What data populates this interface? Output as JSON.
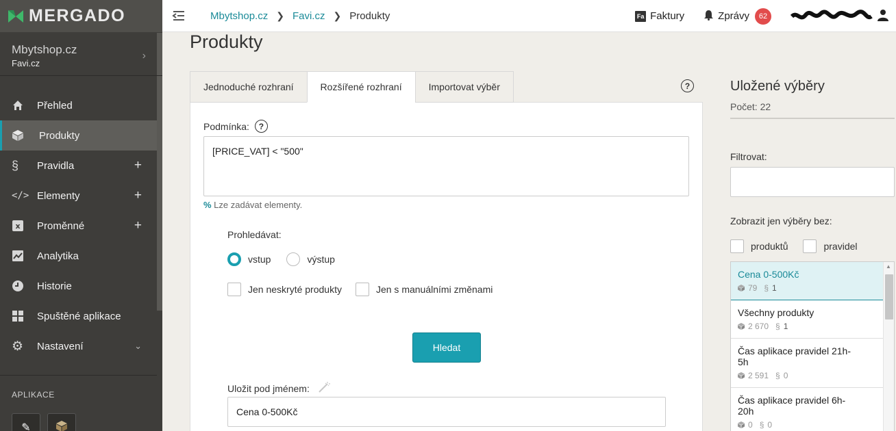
{
  "logo": {
    "text": "MERGADO"
  },
  "shop": {
    "name": "Mbytshop.cz",
    "sub": "Favi.cz"
  },
  "nav": {
    "items": [
      {
        "label": "Přehled",
        "icon": "home-icon"
      },
      {
        "label": "Produkty",
        "icon": "cube-icon",
        "active": true
      },
      {
        "label": "Pravidla",
        "icon": "section-icon",
        "plus": "+"
      },
      {
        "label": "Elementy",
        "icon": "code-icon",
        "plus": "+"
      },
      {
        "label": "Proměnné",
        "icon": "variable-icon",
        "plus": "+"
      },
      {
        "label": "Analytika",
        "icon": "chart-icon"
      },
      {
        "label": "Historie",
        "icon": "clock-icon"
      },
      {
        "label": "Spuštěné aplikace",
        "icon": "apps-grid-icon"
      },
      {
        "label": "Nastavení",
        "icon": "gear-icon"
      }
    ],
    "apps_title": "APLIKACE"
  },
  "topbar": {
    "breadcrumbs": [
      "Mbytshop.cz",
      "Favi.cz",
      "Produkty"
    ],
    "invoices_label": "Faktury",
    "invoices_icon_text": "Fa",
    "messages_label": "Zprávy",
    "messages_count": "62"
  },
  "main": {
    "title": "Produkty",
    "tabs": [
      {
        "label": "Jednoduché rozhraní"
      },
      {
        "label": "Rozšířené rozhraní",
        "active": true
      },
      {
        "label": "Importovat výběr"
      }
    ],
    "help_glyph": "?",
    "condition_label": "Podmínka:",
    "condition_value": "[PRICE_VAT] < \"500\"",
    "hint_symbol": "%",
    "hint_text": " Lze zadávat elementy.",
    "search_in_label": "Prohledávat:",
    "radio_input": "vstup",
    "radio_output": "výstup",
    "check_unhidden": "Jen neskryté produkty",
    "check_manual": "Jen s manuálními změnami",
    "search_button": "Hledat",
    "save_label": "Uložit pod jménem:",
    "save_value": "Cena 0-500Kč"
  },
  "saved": {
    "title": "Uložené výběry",
    "count": "Počet: 22",
    "filter_label": "Filtrovat:",
    "only_without_label": "Zobrazit jen výběry bez:",
    "only_products": "produktů",
    "only_rules": "pravidel",
    "items": [
      {
        "name": "Cena 0-500Kč",
        "products": "79",
        "rules": "1",
        "selected": true
      },
      {
        "name": "Všechny produkty",
        "products": "2 670",
        "rules": "1"
      },
      {
        "name": "Čas aplikace pravidel 21h-5h",
        "products": "2 591",
        "rules": "0"
      },
      {
        "name": "Čas aplikace pravidel 6h-20h",
        "products": "0",
        "rules": "0"
      }
    ],
    "section_glyph": "§"
  },
  "colors": {
    "accent": "#1a9fb0",
    "link": "#1a8a98",
    "sidebar": "#3e3d3a",
    "badge": "#e24c4c"
  }
}
